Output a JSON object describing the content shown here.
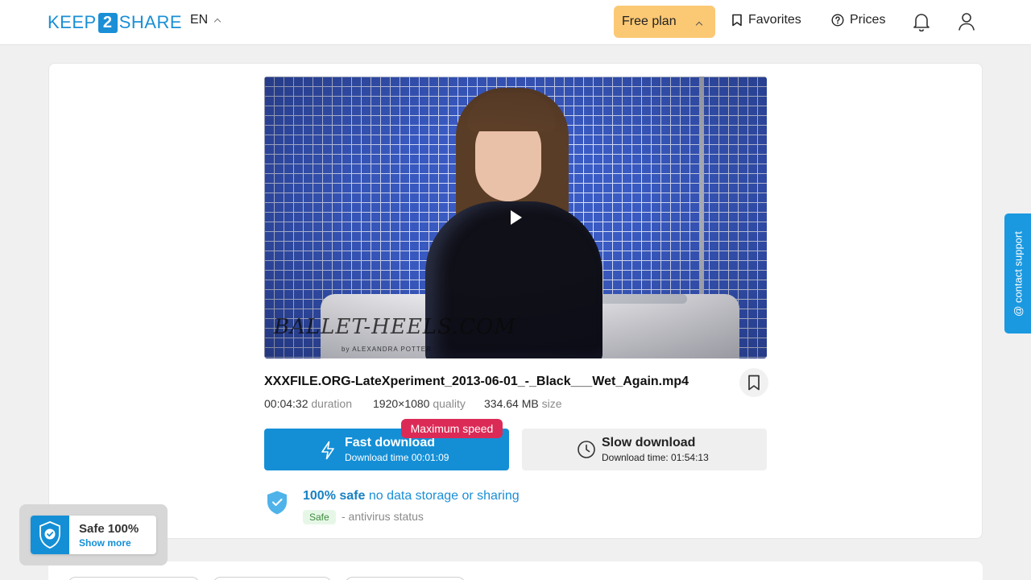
{
  "header": {
    "logo": {
      "pre": "KEEP",
      "num": "2",
      "post": "SHARE"
    },
    "language": "EN",
    "free_plan": "Free plan",
    "favorites": "Favorites",
    "prices": "Prices",
    "icons": [
      "chevron-up-icon",
      "bookmark-icon",
      "question-circle-icon",
      "bell-icon",
      "user-icon"
    ]
  },
  "video": {
    "watermark": "BALLET-HEELS.COM",
    "watermark_sub": "by ALEXANDRA POTTER"
  },
  "file": {
    "name": "XXXFILE.ORG-LateXperiment_2013-06-01_-_Black___Wet_Again.mp4",
    "duration": "00:04:32",
    "duration_label": "duration",
    "quality": "1920×1080",
    "quality_label": "quality",
    "size": "334.64 MB",
    "size_label": "size"
  },
  "download": {
    "fast_label": "Fast download",
    "fast_time": "Download time 00:01:09",
    "max_speed_badge": "Maximum speed",
    "slow_label": "Slow download",
    "slow_time": "Download time: 01:54:13"
  },
  "safety": {
    "headline_bold": "100% safe",
    "headline_rest": "no data storage or sharing",
    "tag": "Safe",
    "status": "- antivirus status"
  },
  "widget": {
    "title": "Safe 100%",
    "link": "Show more"
  },
  "support": {
    "label": "@ contact support"
  },
  "colors": {
    "accent": "#148fd6",
    "free_plan_bg": "#fbc874",
    "badge_red": "#dc2a56",
    "safe_green_bg": "#e7f7e7"
  }
}
